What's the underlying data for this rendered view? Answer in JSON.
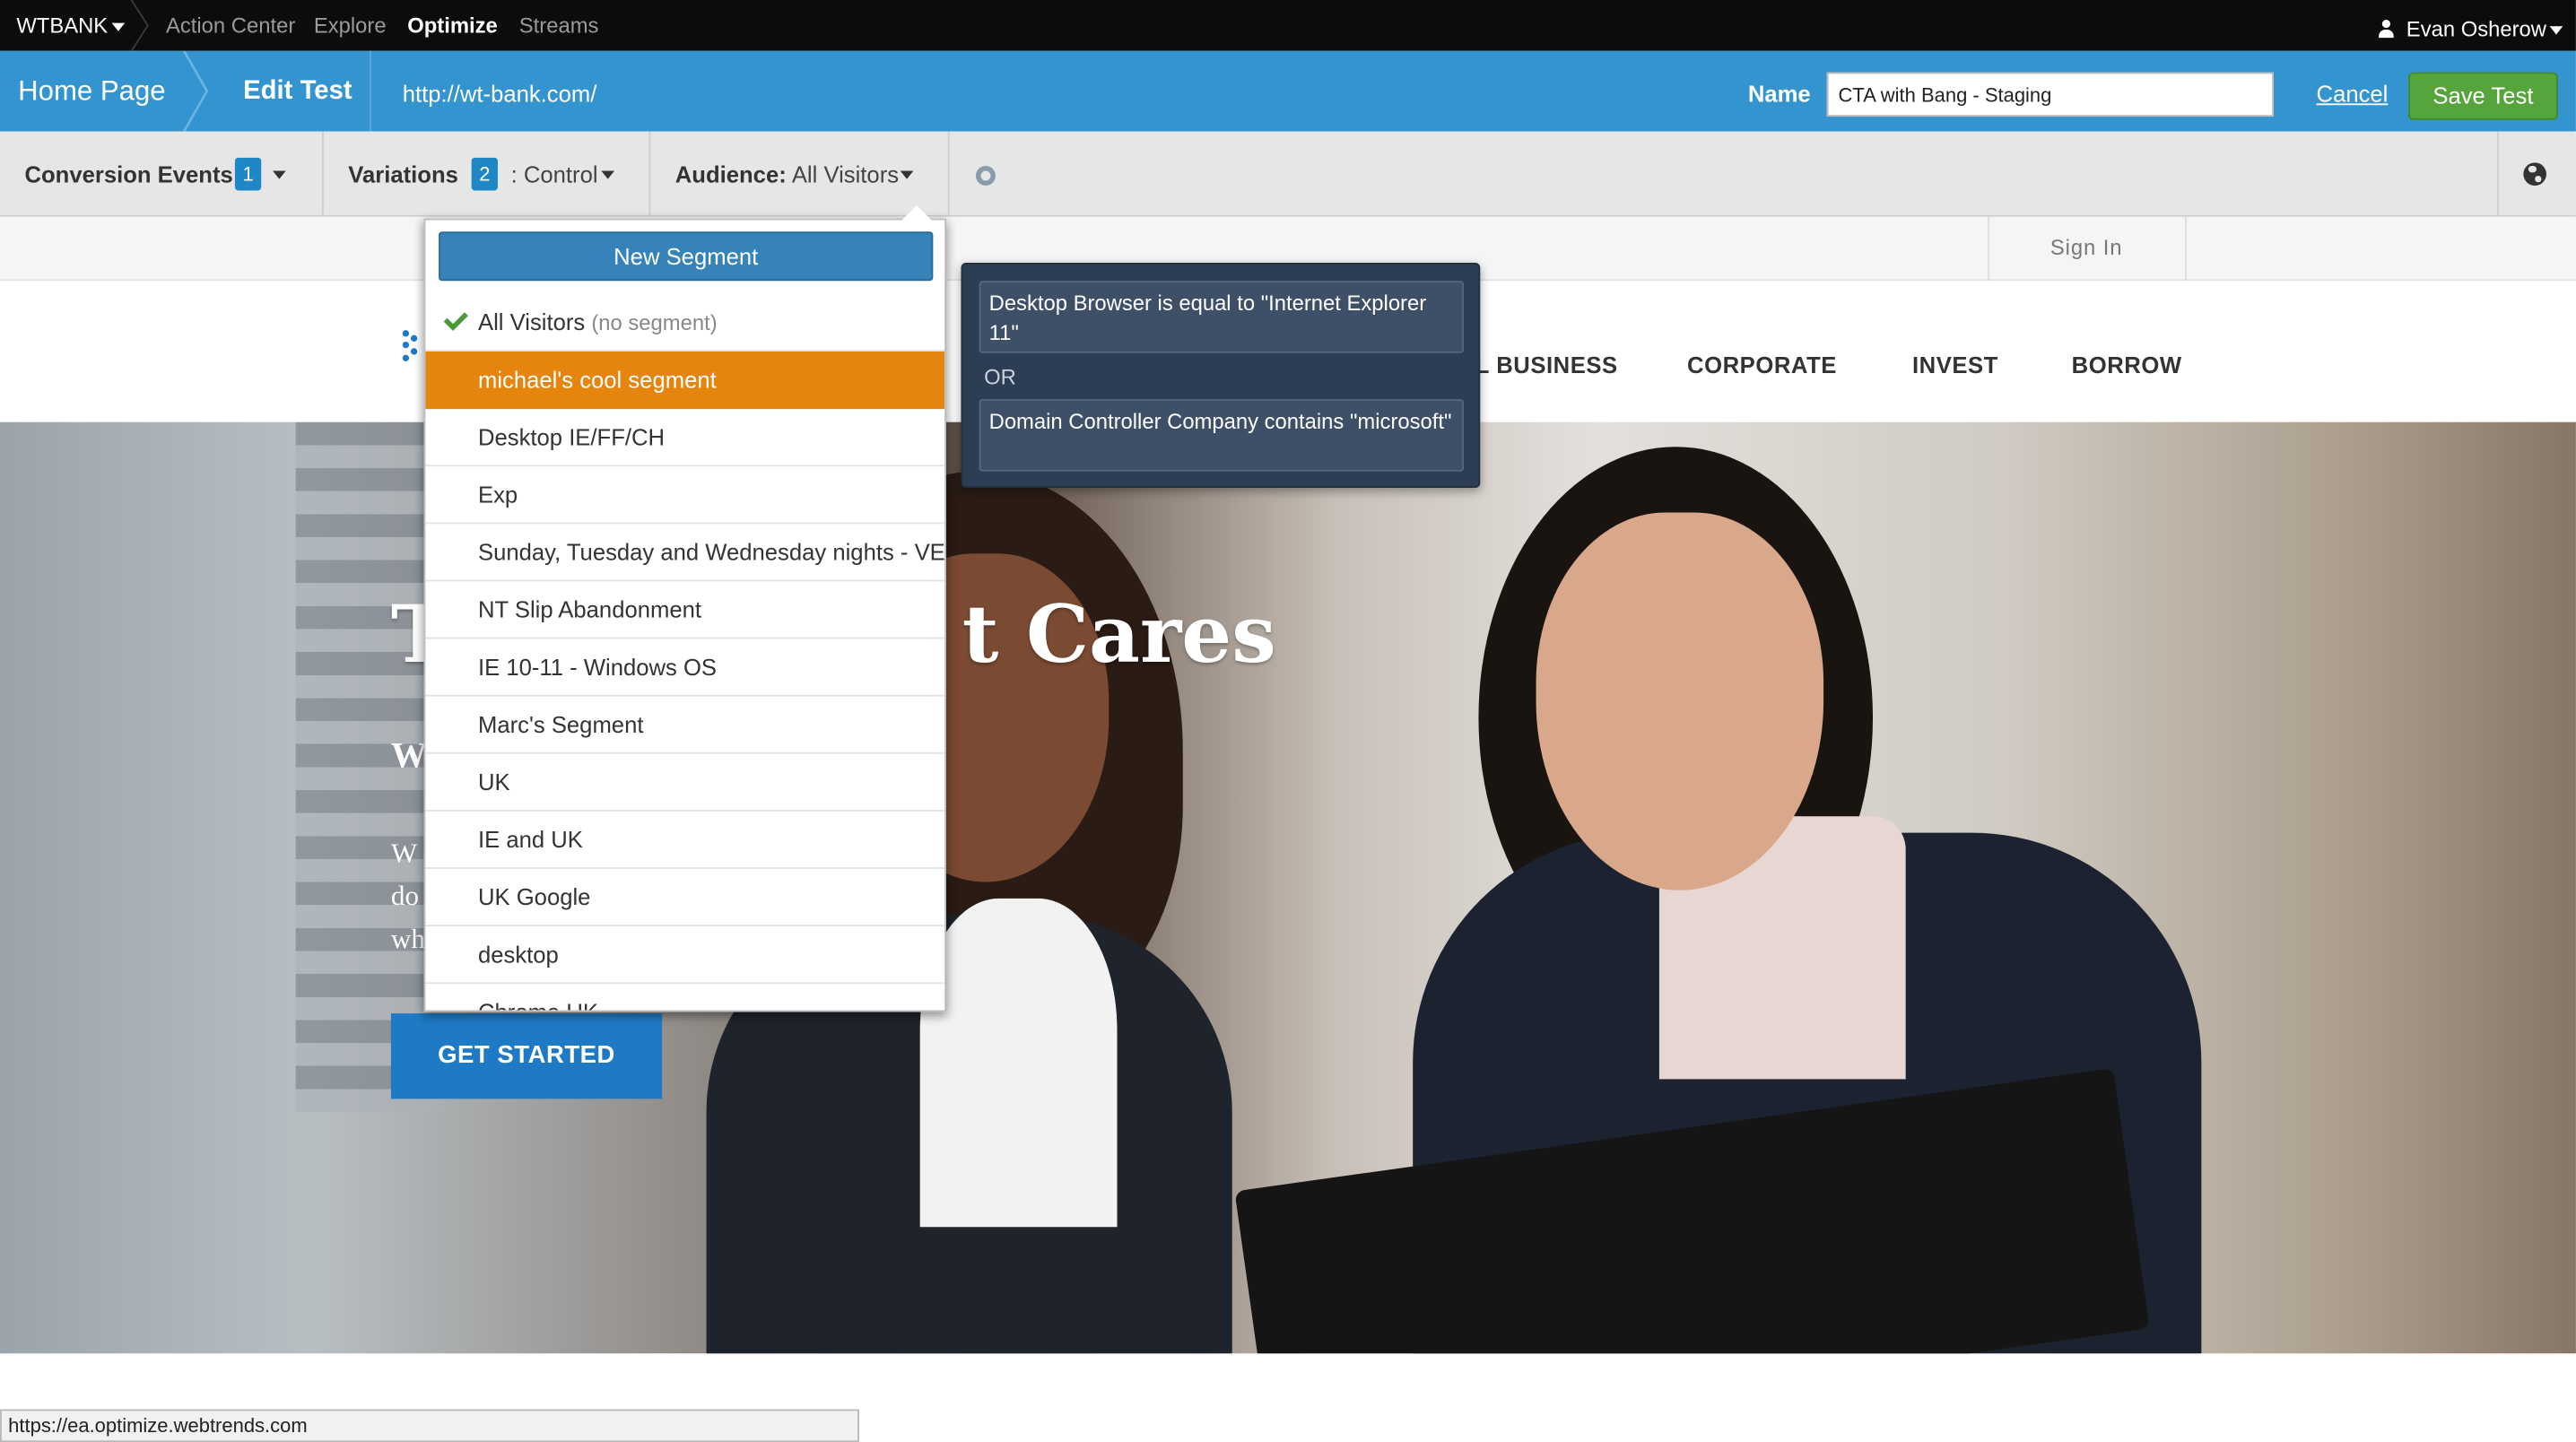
{
  "topnav": {
    "brand": "WTBANK",
    "items": [
      "Action Center",
      "Explore",
      "Optimize",
      "Streams"
    ],
    "active": "Optimize",
    "user": "Evan Osherow"
  },
  "header": {
    "breadcrumb_home": "Home Page",
    "breadcrumb_current": "Edit Test",
    "url": "http://wt-bank.com/",
    "name_label": "Name",
    "name_value": "CTA with Bang - Staging",
    "cancel_label": "Cancel",
    "save_label": "Save Test"
  },
  "toolbar": {
    "conversion_label": "Conversion Events",
    "conversion_count": "1",
    "variations_label": "Variations",
    "variations_count": "2",
    "variations_value": ": Control",
    "audience_label": "Audience:",
    "audience_value": "All Visitors"
  },
  "site": {
    "signin": "Sign In",
    "nav": [
      "L BUSINESS",
      "CORPORATE",
      "INVEST",
      "BORROW"
    ],
    "headline_left": "T",
    "headline_right": "t Cares",
    "sub": "W",
    "para": [
      "W",
      "do",
      "wh"
    ],
    "cta": "GET STARTED"
  },
  "segments": {
    "new_segment_label": "New Segment",
    "selected": "All Visitors",
    "selected_note": "(no segment)",
    "items": [
      "michael's cool segment",
      "Desktop IE/FF/CH",
      "Exp",
      "Sunday, Tuesday and Wednesday nights - VE",
      "NT Slip Abandonment",
      "IE 10-11 - Windows OS",
      "Marc's Segment",
      "UK",
      "IE and UK",
      "UK Google",
      "desktop",
      "Chrome UK"
    ],
    "highlighted": "michael's cool segment"
  },
  "tooltip": {
    "rule1": "Desktop Browser is equal to \"Internet Explorer 11\"",
    "or": "OR",
    "rule2": "Domain Controller Company contains \"microsoft\""
  },
  "statusbar": {
    "url": "https://ea.optimize.webtrends.com"
  },
  "colors": {
    "topnav_bg": "#0c0c0c",
    "header_bg": "#3394cf",
    "save_button": "#55a53c",
    "highlight": "#e6850e",
    "tooltip_bg": "#2d3e54",
    "cta_bg": "#1e7ac4"
  }
}
